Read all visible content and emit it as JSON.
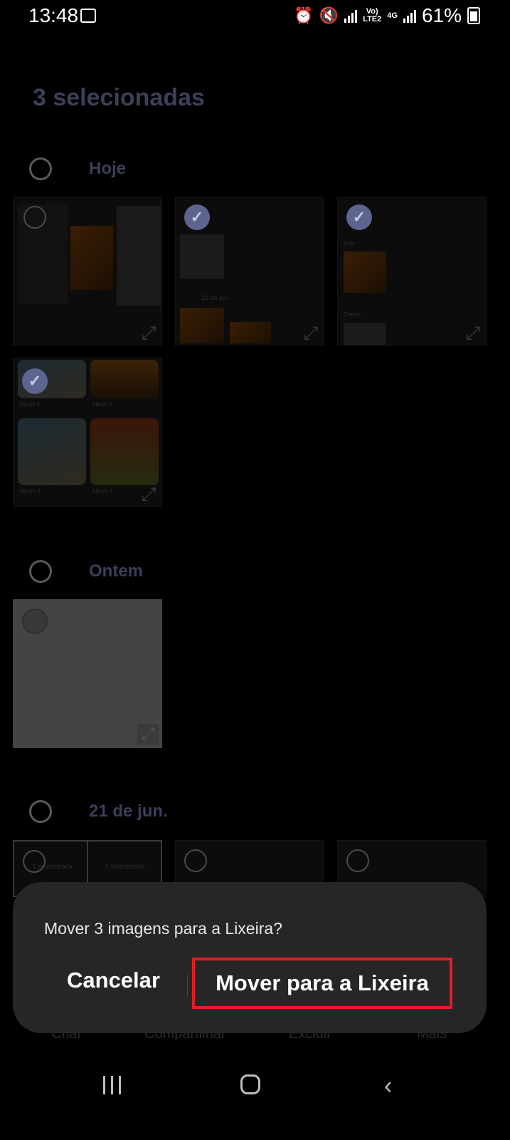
{
  "status_bar": {
    "time": "13:48",
    "network_top": "Vo)",
    "network_bottom": "LTE2",
    "net_type": "4G",
    "battery": "61%"
  },
  "header": {
    "title": "3 selecionadas"
  },
  "sections": [
    {
      "label": "Hoje"
    },
    {
      "label": "Ontem"
    },
    {
      "label": "21 de jun."
    }
  ],
  "thumb_texts": {
    "t2_date": "21 de jun.",
    "t3_label1": "Hoje",
    "t3_label2": "Ontem",
    "album1": "Álbum 1",
    "album2": "Álbum 2",
    "album3": "Álbum 3",
    "album4": "Álbum 4",
    "sel1": "1 selecionada",
    "sel2": "1 selecionada"
  },
  "bottom_bar": {
    "items": [
      "Criar",
      "Compartilhar",
      "Excluir",
      "Mais"
    ]
  },
  "dialog": {
    "message": "Mover 3 imagens para a Lixeira?",
    "cancel_label": "Cancelar",
    "confirm_label": "Mover para a Lixeira",
    "highlight_color": "#e01e25"
  },
  "icons": {
    "check": "✓",
    "expand": "⤢",
    "back": "‹"
  }
}
